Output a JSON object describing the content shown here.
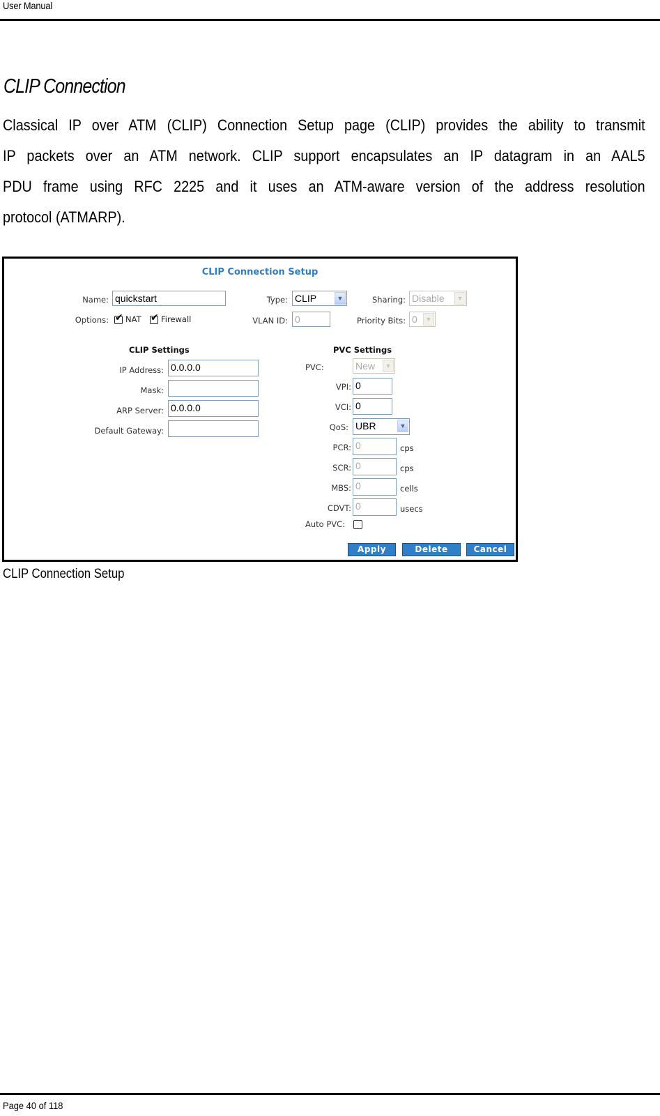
{
  "document": {
    "running_header": "User Manual",
    "section_title": "CLIP Connection",
    "body_lines": [
      "Classical IP over ATM (CLIP) Connection Setup page (CLIP) provides the ability to transmit",
      "IP packets over an ATM network. CLIP support encapsulates an IP datagram in an AAL5",
      "PDU frame using RFC 2225 and it uses an ATM-aware version of the address resolution",
      "protocol (ATMARP)."
    ],
    "figure_caption": "CLIP Connection Setup",
    "footer": "Page 40  of 118"
  },
  "screenshot": {
    "title": "CLIP Connection Setup",
    "colors": {
      "title": "#2f7fc8",
      "button": "#2f80c9",
      "input_border": "#7f9db9"
    },
    "top": {
      "name_label": "Name:",
      "name_value": "quickstart",
      "type_label": "Type:",
      "type_value": "CLIP",
      "sharing_label": "Sharing:",
      "sharing_value": "Disable",
      "options_label": "Options:",
      "options": [
        {
          "label": "NAT",
          "checked": true
        },
        {
          "label": "Firewall",
          "checked": true
        }
      ],
      "vlan_label": "VLAN ID:",
      "vlan_value": "0",
      "priority_label": "Priority Bits:",
      "priority_value": "0"
    },
    "clip_settings": {
      "heading": "CLIP Settings",
      "fields": [
        {
          "label": "IP Address:",
          "value": "0.0.0.0"
        },
        {
          "label": "Mask:",
          "value": ""
        },
        {
          "label": "ARP Server:",
          "value": "0.0.0.0"
        },
        {
          "label": "Default Gateway:",
          "value": ""
        }
      ]
    },
    "pvc_settings": {
      "heading": "PVC Settings",
      "pvc_label": "PVC:",
      "pvc_value": "New",
      "vpi_label": "VPI:",
      "vpi_value": "0",
      "vci_label": "VCI:",
      "vci_value": "0",
      "qos_label": "QoS:",
      "qos_value": "UBR",
      "rates": [
        {
          "label": "PCR:",
          "value": "0",
          "unit": "cps"
        },
        {
          "label": "SCR:",
          "value": "0",
          "unit": "cps"
        },
        {
          "label": "MBS:",
          "value": "0",
          "unit": "cells"
        },
        {
          "label": "CDVT:",
          "value": "0",
          "unit": "usecs"
        }
      ],
      "auto_pvc_label": "Auto PVC:",
      "auto_pvc_checked": false
    },
    "buttons": {
      "apply": "Apply",
      "delete": "Delete",
      "cancel": "Cancel"
    },
    "icons": {
      "dropdown": "▼",
      "check": "✔"
    }
  }
}
